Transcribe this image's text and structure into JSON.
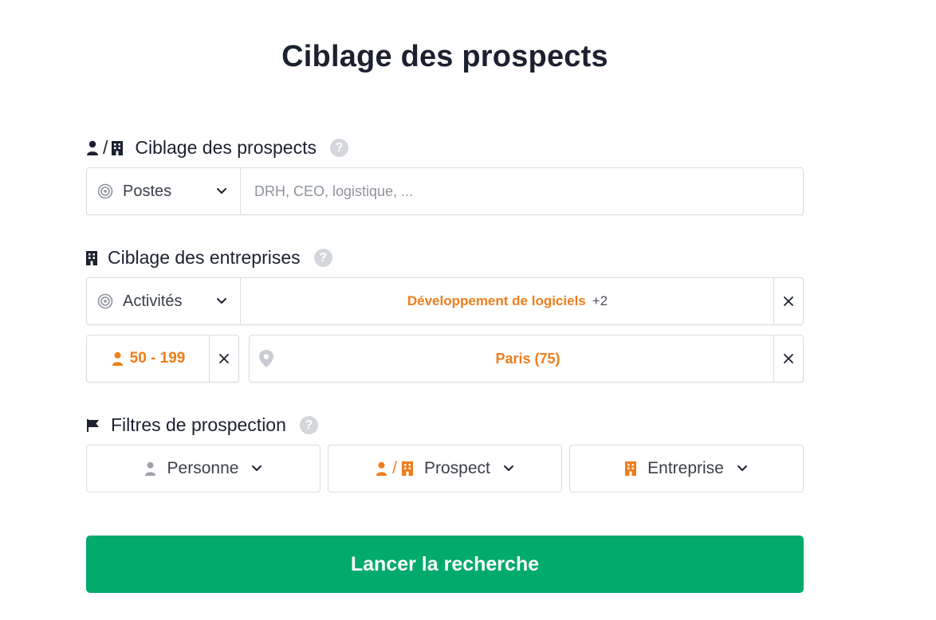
{
  "page": {
    "title": "Ciblage des prospects"
  },
  "sections": {
    "prospects": {
      "label": "Ciblage des prospects",
      "help": "?",
      "separator": "/",
      "select_label": "Postes",
      "input_placeholder": "DRH, CEO, logistique, ..."
    },
    "companies": {
      "label": "Ciblage des entreprises",
      "help": "?",
      "activity_select": "Activités",
      "activity_value": "Développement de logiciels",
      "activity_more": "+2",
      "size_value": "50 - 199",
      "location_value": "Paris (75)"
    },
    "filters": {
      "label": "Filtres de prospection",
      "help": "?",
      "person": "Personne",
      "prospect": "Prospect",
      "prospect_separator": "/",
      "company": "Entreprise"
    }
  },
  "search_button": "Lancer la recherche",
  "colors": {
    "accent": "#ef7d1a",
    "primary": "#02aa6c",
    "text": "#1b2130",
    "border": "#d9dce1"
  },
  "icons": [
    "person-icon",
    "building-icon",
    "help-icon",
    "target-icon",
    "chevron-down-icon",
    "close-icon",
    "map-pin-icon",
    "flag-icon"
  ]
}
